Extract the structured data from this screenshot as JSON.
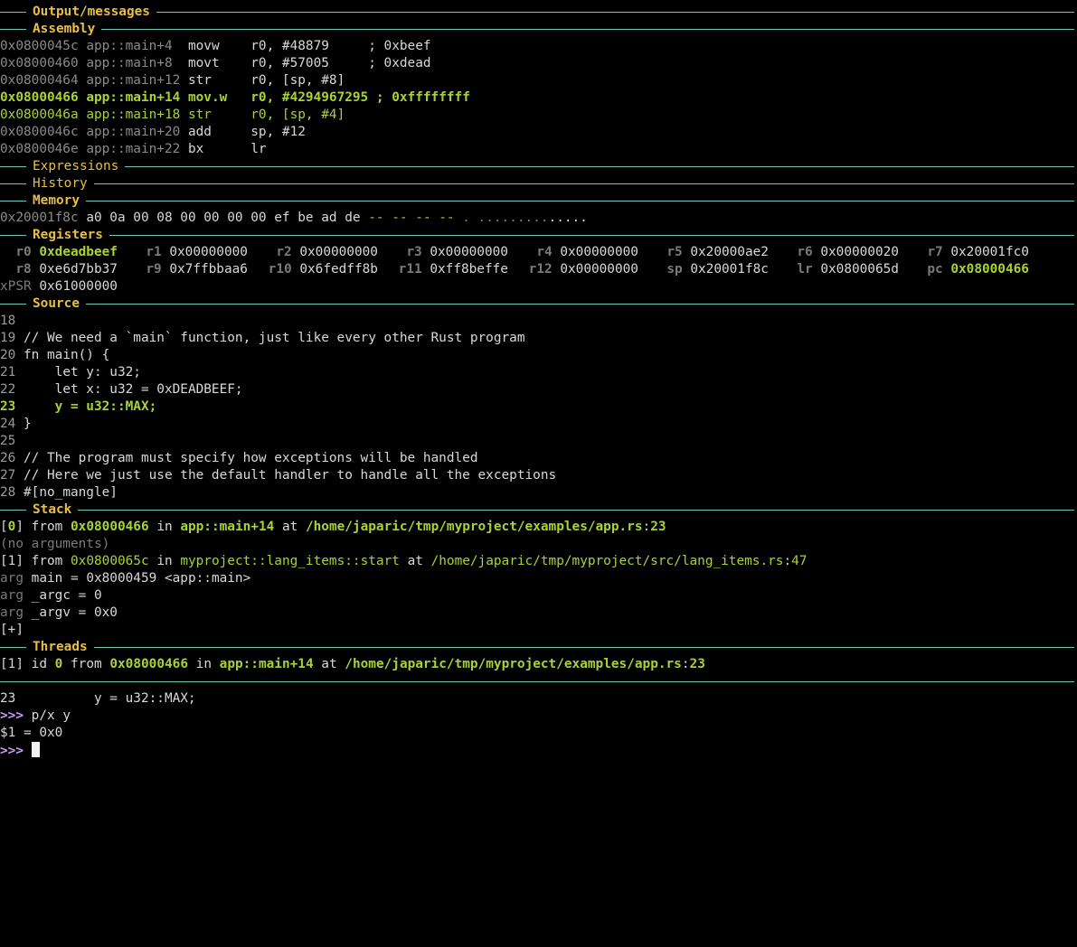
{
  "sections": {
    "output": "Output/messages",
    "assembly": "Assembly",
    "expressions": "Expressions",
    "history": "History",
    "memory": "Memory",
    "registers": "Registers",
    "source": "Source",
    "stack": "Stack",
    "threads": "Threads"
  },
  "assembly": [
    {
      "addr": "0x0800045c",
      "sym": "app::main+4 ",
      "mnem": "movw  ",
      "ops": "r0, #48879     ",
      "comment": "; 0xbeef",
      "current": false
    },
    {
      "addr": "0x08000460",
      "sym": "app::main+8 ",
      "mnem": "movt  ",
      "ops": "r0, #57005     ",
      "comment": "; 0xdead",
      "current": false
    },
    {
      "addr": "0x08000464",
      "sym": "app::main+12",
      "mnem": "str   ",
      "ops": "r0, [sp, #8]",
      "comment": "",
      "current": false
    },
    {
      "addr": "0x08000466",
      "sym": "app::main+14",
      "mnem": "mov.w ",
      "ops": "r0, #4294967295 ",
      "comment": "; 0xffffffff",
      "current": true
    },
    {
      "addr": "0x0800046a",
      "sym": "app::main+18",
      "mnem": "str   ",
      "ops": "r0, [sp, #4]",
      "comment": "",
      "current": false,
      "stale": true
    },
    {
      "addr": "0x0800046c",
      "sym": "app::main+20",
      "mnem": "add   ",
      "ops": "sp, #12",
      "comment": "",
      "current": false
    },
    {
      "addr": "0x0800046e",
      "sym": "app::main+22",
      "mnem": "bx    ",
      "ops": "lr",
      "comment": "",
      "current": false
    }
  ],
  "memory": {
    "addr": "0x20001f8c",
    "bytes": "a0 0a 00 08 00 00 00 00 ef be ad de",
    "unknown": "-- -- -- --",
    "ascii_dim": ". .........",
    "ascii": "....."
  },
  "registers": {
    "row1": [
      {
        "name": "  r0",
        "value": "0xdeadbeef",
        "changed": true
      },
      {
        "name": "  r1",
        "value": "0x00000000",
        "changed": false
      },
      {
        "name": "  r2",
        "value": "0x00000000",
        "changed": false
      },
      {
        "name": "  r3",
        "value": "0x00000000",
        "changed": false
      },
      {
        "name": "  r4",
        "value": "0x00000000",
        "changed": false
      },
      {
        "name": "  r5",
        "value": "0x20000ae2",
        "changed": false
      },
      {
        "name": "  r6",
        "value": "0x00000020",
        "changed": false
      },
      {
        "name": "  r7",
        "value": "0x20001fc0",
        "changed": false
      }
    ],
    "row2": [
      {
        "name": "  r8",
        "value": "0xe6d7bb37",
        "changed": false
      },
      {
        "name": "  r9",
        "value": "0x7ffbbaa6",
        "changed": false
      },
      {
        "name": " r10",
        "value": "0x6fedff8b",
        "changed": false
      },
      {
        "name": " r11",
        "value": "0xff8beffe",
        "changed": false
      },
      {
        "name": " r12",
        "value": "0x00000000",
        "changed": false
      },
      {
        "name": "  sp",
        "value": "0x20001f8c",
        "changed": false
      },
      {
        "name": "  lr",
        "value": "0x0800065d",
        "changed": false
      },
      {
        "name": "  pc",
        "value": "0x08000466",
        "changed": true
      }
    ],
    "xpsr": {
      "name": "xPSR",
      "value": "0x61000000"
    }
  },
  "source": [
    {
      "num": "18",
      "code": "",
      "current": false
    },
    {
      "num": "19",
      "code": "// We need a `main` function, just like every other Rust program",
      "current": false
    },
    {
      "num": "20",
      "code": "fn main() {",
      "current": false
    },
    {
      "num": "21",
      "code": "    let y: u32;",
      "current": false
    },
    {
      "num": "22",
      "code": "    let x: u32 = 0xDEADBEEF;",
      "current": false
    },
    {
      "num": "23",
      "code": "    y = u32::MAX;",
      "current": true
    },
    {
      "num": "24",
      "code": "}",
      "current": false
    },
    {
      "num": "25",
      "code": "",
      "current": false
    },
    {
      "num": "26",
      "code": "// The program must specify how exceptions will be handled",
      "current": false
    },
    {
      "num": "27",
      "code": "// Here we just use the default handler to handle all the exceptions",
      "current": false
    },
    {
      "num": "28",
      "code": "#[no_mangle]",
      "current": false
    }
  ],
  "stack": {
    "frame0": {
      "idx": "0",
      "from": "from",
      "addr": "0x08000466",
      "in": "in",
      "func": "app::main+14",
      "at": "at",
      "file": "/home/japaric/tmp/myproject/examples/app.rs",
      "line": "23"
    },
    "no_args": "(no arguments)",
    "frame1": {
      "idx": "1",
      "from": "from",
      "addr": "0x0800065c",
      "in": "in",
      "func": "myproject::lang_items::start",
      "at": "at",
      "file": "/home/japaric/tmp/myproject/src/lang_items.rs",
      "line": "47"
    },
    "args": [
      {
        "kw": "arg",
        "text": "main = 0x8000459 <app::main>"
      },
      {
        "kw": "arg",
        "text": "_argc = 0"
      },
      {
        "kw": "arg",
        "text": "_argv = 0x0"
      }
    ],
    "more": "[+]"
  },
  "threads": {
    "idx": "1",
    "id_kw": "id",
    "id": "0",
    "from": "from",
    "addr": "0x08000466",
    "in": "in",
    "func": "app::main+14",
    "at": "at",
    "file": "/home/japaric/tmp/myproject/examples/app.rs",
    "line": "23"
  },
  "console": {
    "echo_num": "23",
    "echo_code": "          y = u32::MAX;",
    "prompt": ">>>",
    "cmd": "p/x y",
    "result": "$1 = 0x0"
  },
  "colors": {
    "accent_title": "#e8bf42",
    "rule": "#6cc7bd",
    "highlight": "#a9d233",
    "prompt": "#c79cf4",
    "background": "#000000"
  }
}
